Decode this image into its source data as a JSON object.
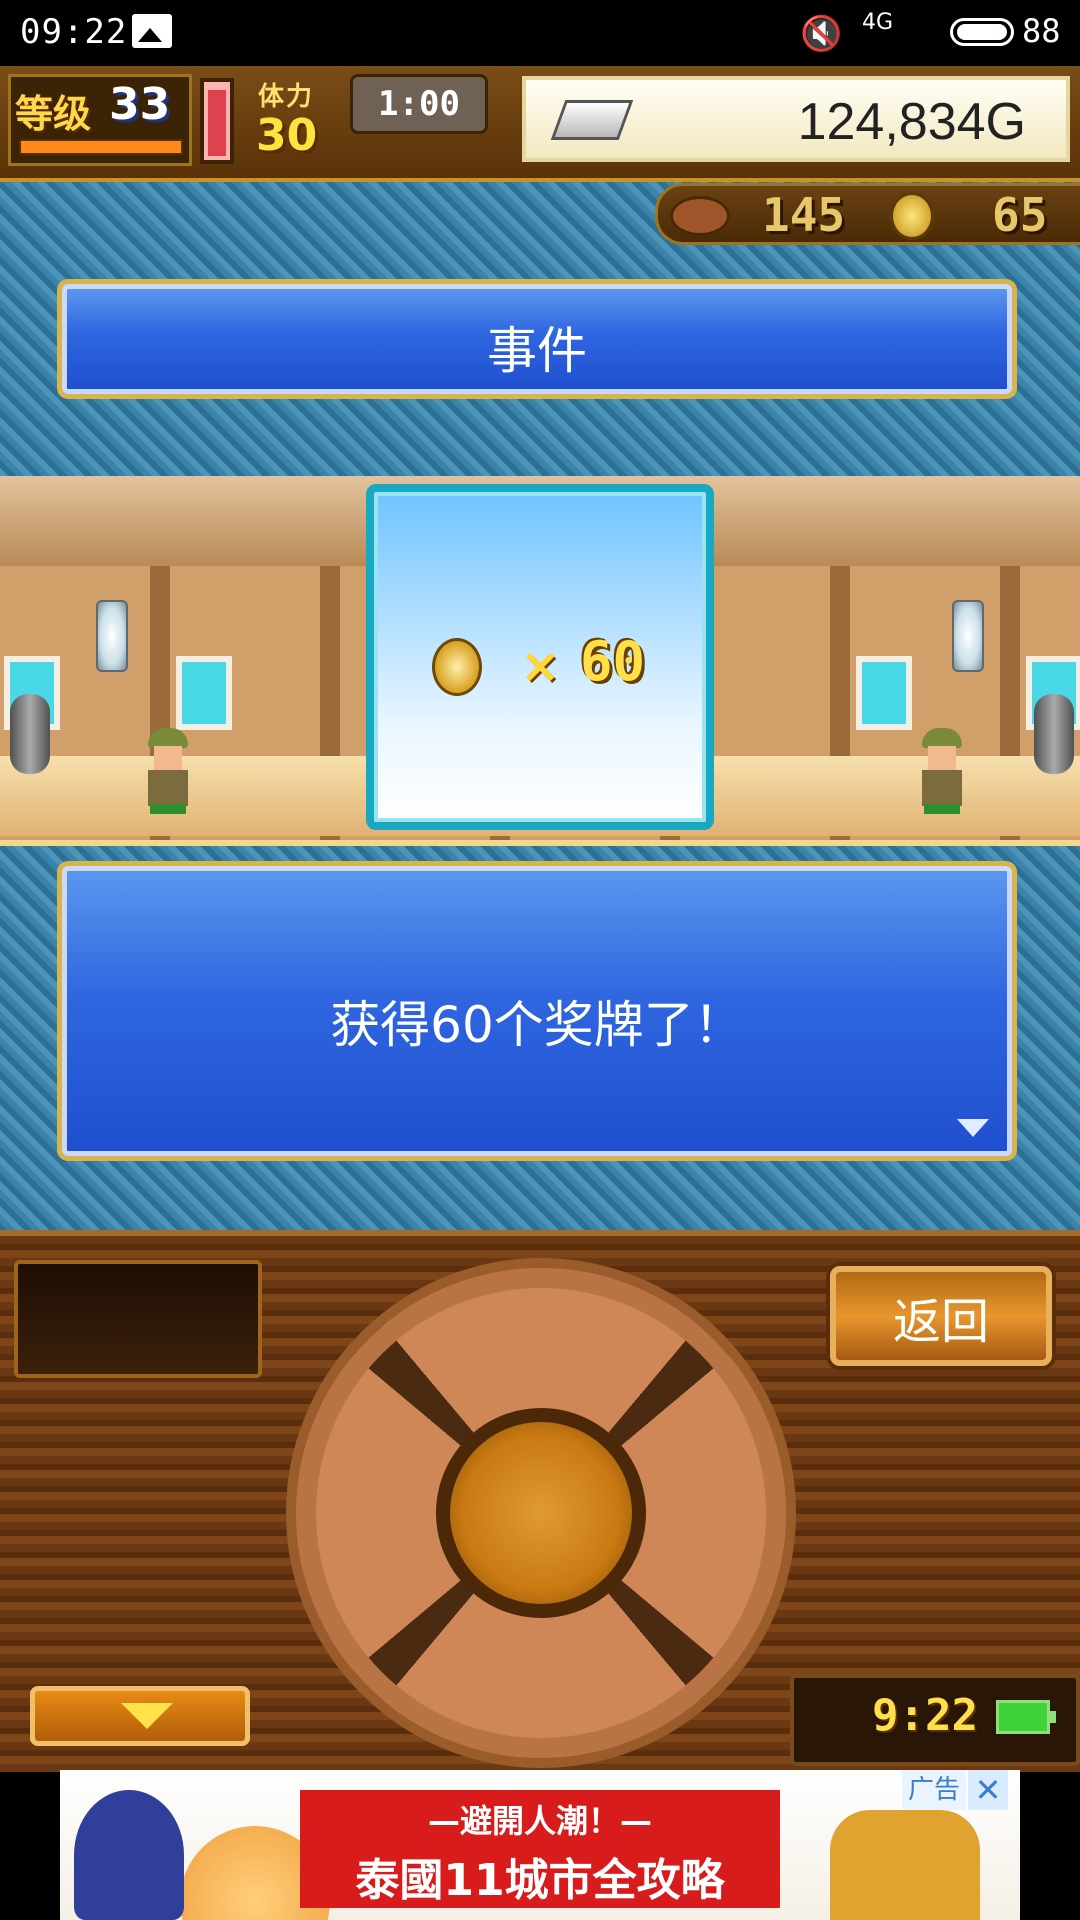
{
  "status_bar": {
    "time": "09:22",
    "network": "4G",
    "battery": "88",
    "icons": [
      "image-icon",
      "mute-icon",
      "signal-icon",
      "battery-icon"
    ]
  },
  "hud": {
    "level_label": "等级",
    "level": "33",
    "stamina_label": "体力",
    "stamina": "30",
    "timer": "1:00",
    "gold": "124,834G",
    "meat": "145",
    "medals": "65"
  },
  "event": {
    "title": "事件",
    "reward_multiplier": "×",
    "reward_quantity": "60",
    "message": "获得60个奖牌了！"
  },
  "controller": {
    "back_label": "返回",
    "clock": "9:22"
  },
  "ad": {
    "line1": "—避開人潮！—",
    "line2": "泰國11城市全攻略",
    "tag": "广告",
    "close": "✕"
  },
  "colors": {
    "panel_blue": "#2f66e0",
    "panel_border_gold": "#d9b448",
    "card_border": "#18a8c2",
    "wood": "#7e4618",
    "medal_gold": "#ffe04a"
  }
}
